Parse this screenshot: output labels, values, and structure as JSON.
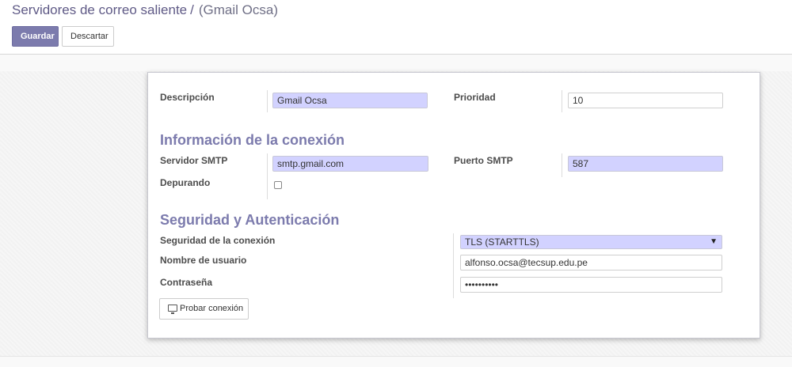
{
  "breadcrumb": {
    "parent": "Servidores de correo saliente",
    "separator": "/",
    "current": "(Gmail Ocsa)"
  },
  "buttons": {
    "save": "Guardar",
    "discard": "Descartar"
  },
  "form": {
    "description_label": "Descripción",
    "description_value": "Gmail Ocsa",
    "priority_label": "Prioridad",
    "priority_value": "10",
    "connection_section": "Información de la conexión",
    "smtp_server_label": "Servidor SMTP",
    "smtp_server_value": "smtp.gmail.com",
    "smtp_port_label": "Puerto SMTP",
    "smtp_port_value": "587",
    "debug_label": "Depurando",
    "debug_checked": false,
    "security_section": "Seguridad y Autenticación",
    "conn_security_label": "Seguridad de la conexión",
    "conn_security_value": "TLS (STARTTLS)",
    "username_label": "Nombre de usuario",
    "username_value": "alfonso.ocsa@tecsup.edu.pe",
    "password_label": "Contraseña",
    "password_value": "••••••••••",
    "test_button": "Probar conexión"
  },
  "colors": {
    "accent": "#7c7bad",
    "required_field": "#d2d2ff"
  },
  "icons": {
    "test_button_icon": "monitor-icon",
    "select_arrow": "caret-down-icon"
  }
}
